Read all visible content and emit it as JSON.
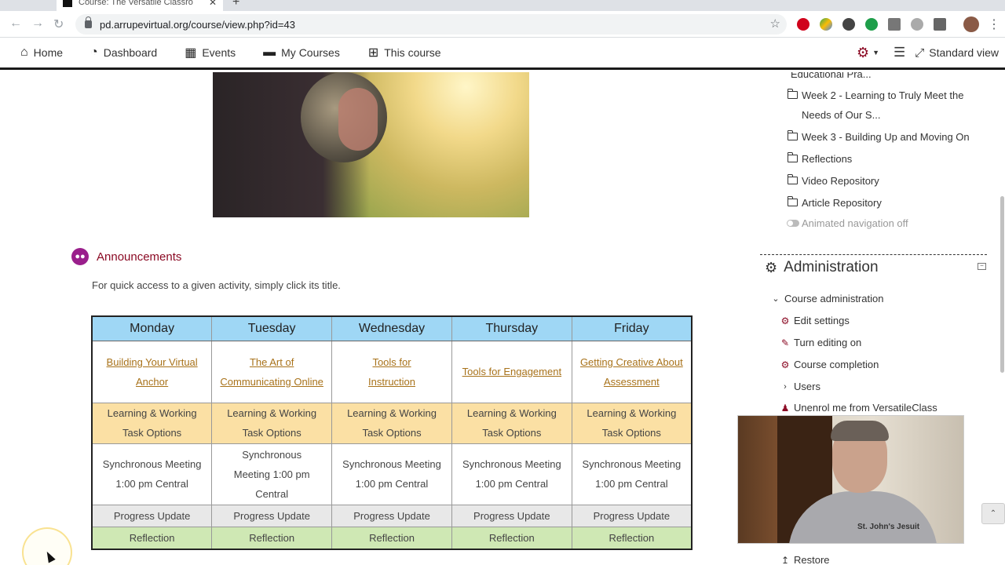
{
  "browser": {
    "tab_title": "Course: The Versatile Classro",
    "url": "pd.arrupevirtual.org/course/view.php?id=43"
  },
  "navbar": {
    "items": [
      {
        "label": "Home",
        "icon": "home-icon"
      },
      {
        "label": "Dashboard",
        "icon": "dashboard-icon"
      },
      {
        "label": "Events",
        "icon": "calendar-icon"
      },
      {
        "label": "My Courses",
        "icon": "briefcase-icon"
      },
      {
        "label": "This course",
        "icon": "sitemap-icon"
      }
    ],
    "standard_view": "Standard view"
  },
  "announcements": {
    "title": "Announcements",
    "intro": "For quick access to a given activity, simply click its title."
  },
  "schedule": {
    "days": [
      "Monday",
      "Tuesday",
      "Wednesday",
      "Thursday",
      "Friday"
    ],
    "links": [
      "Building Your Virtual Anchor",
      "The Art of Communicating Online",
      "Tools for Instruction",
      "Tools for Engagement",
      "Getting Creative About Assessment"
    ],
    "task": [
      "Learning & Working Task Options",
      "Learning & Working Task Options",
      "Learning & Working Task Options",
      "Learning & Working Task Options",
      "Learning & Working Task Options"
    ],
    "sync": [
      "Synchronous Meeting 1:00 pm Central",
      "Synchronous Meeting 1:00 pm Central",
      "Synchronous Meeting 1:00 pm Central",
      "Synchronous Meeting 1:00 pm Central",
      "Synchronous Meeting 1:00 pm Central"
    ],
    "progress": [
      "Progress Update",
      "Progress Update",
      "Progress Update",
      "Progress Update",
      "Progress Update"
    ],
    "reflection": [
      "Reflection",
      "Reflection",
      "Reflection",
      "Reflection",
      "Reflection"
    ]
  },
  "sidebar": {
    "nav_items": [
      "Educational Pra...",
      "Week 2 - Learning to Truly Meet the Needs of Our S...",
      "Week 3 - Building Up and Moving On",
      "Reflections",
      "Video Repository",
      "Article Repository"
    ],
    "animated_nav": "Animated navigation off",
    "admin_title": "Administration",
    "admin_items": [
      "Course administration",
      "Edit settings",
      "Turn editing on",
      "Course completion",
      "Users",
      "Unenrol me from VersatileClass",
      "Restore"
    ]
  },
  "video": {
    "shirt_text": "St. John's Jesuit"
  }
}
